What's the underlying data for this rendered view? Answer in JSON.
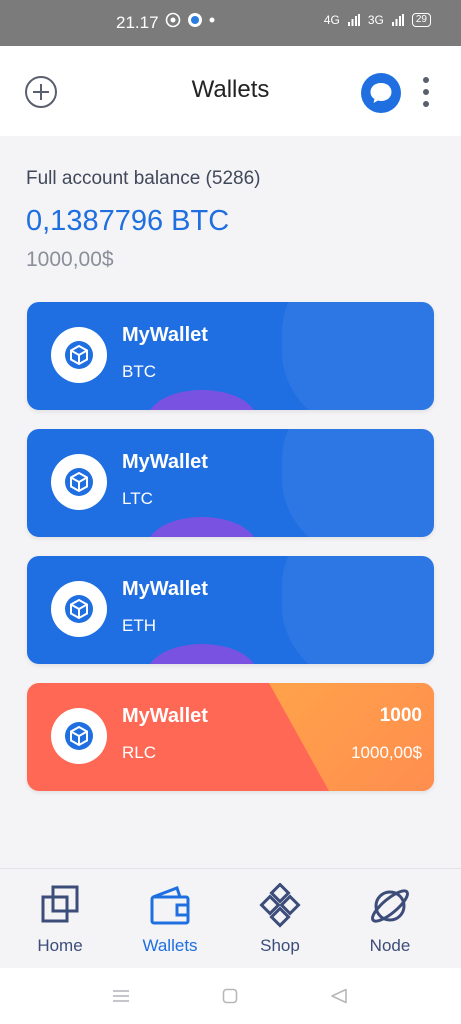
{
  "status_bar": {
    "time": "21.17",
    "network1": "4G",
    "network2": "3G",
    "battery": "29"
  },
  "app_bar": {
    "title": "Wallets"
  },
  "balance": {
    "label": "Full account balance (5286)",
    "btc": "0,1387796 BTC",
    "usd": "1000,00$"
  },
  "wallets": [
    {
      "name": "MyWallet",
      "symbol": "BTC",
      "amount": "",
      "fiat": ""
    },
    {
      "name": "MyWallet",
      "symbol": "LTC",
      "amount": "",
      "fiat": ""
    },
    {
      "name": "MyWallet",
      "symbol": "ETH",
      "amount": "",
      "fiat": ""
    },
    {
      "name": "MyWallet",
      "symbol": "RLC",
      "amount": "1000",
      "fiat": "1000,00$"
    }
  ],
  "nav": [
    {
      "label": "Home",
      "icon": "home-squares-icon"
    },
    {
      "label": "Wallets",
      "icon": "wallet-icon",
      "active": true
    },
    {
      "label": "Shop",
      "icon": "shop-diamond-icon"
    },
    {
      "label": "Node",
      "icon": "planet-icon"
    }
  ],
  "colors": {
    "primary": "#1f6fe0",
    "card_blue": "#1f6fe3",
    "card_orange": "#ff6855",
    "nav_inactive": "#3d4d7a"
  }
}
